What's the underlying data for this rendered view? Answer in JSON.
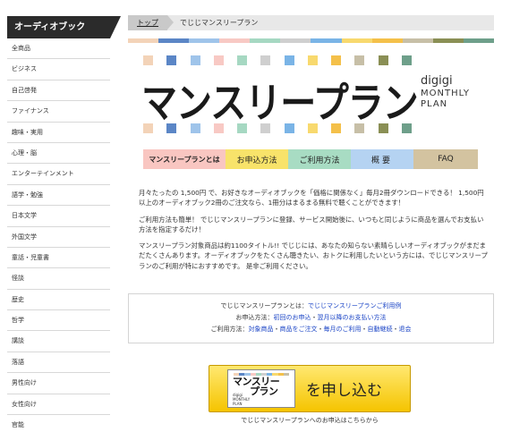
{
  "sidebar": {
    "heading": "オーディオブック",
    "items": [
      {
        "label": "全商品"
      },
      {
        "label": "ビジネス"
      },
      {
        "label": "自己啓発"
      },
      {
        "label": "ファイナンス"
      },
      {
        "label": "趣味・実用"
      },
      {
        "label": "心理・脳"
      },
      {
        "label": "エンターテインメント"
      },
      {
        "label": "語学・勉強"
      },
      {
        "label": "日本文学"
      },
      {
        "label": "外国文学"
      },
      {
        "label": "童話・児童書"
      },
      {
        "label": "怪談"
      },
      {
        "label": "歴史"
      },
      {
        "label": "哲学"
      },
      {
        "label": "講談"
      },
      {
        "label": "落語"
      },
      {
        "label": "男性向け"
      },
      {
        "label": "女性向け"
      },
      {
        "label": "官能"
      }
    ]
  },
  "breadcrumb": {
    "home": "トップ",
    "current": "でじじマンスリープラン"
  },
  "colors": {
    "palette": [
      "#f3d3b8",
      "#5b86c6",
      "#9fc4ea",
      "#f8c9c4",
      "#a6d8c2",
      "#cfcfcf",
      "#7ab4e6",
      "#f8d96e",
      "#f4c04a",
      "#c7bfa7",
      "#8a8f55",
      "#6e9f8a"
    ]
  },
  "logo": {
    "main": "マンスリープラン",
    "side_line1": "digigi",
    "side_line2": "MONTHLY",
    "side_line3": "PLAN"
  },
  "tabs": {
    "about": "マンスリープランとは",
    "apply": "お申込方法",
    "usage": "ご利用方法",
    "overview": "概要",
    "faq": "FAQ"
  },
  "intro": {
    "p1": "月々たったの 1,500円 で、お好きなオーディオブックを「価格に関係なく」毎月2冊ダウンロードできる！ 1,500円以上のオーディオブック2冊のご注文なら、1冊分はまるまる無料で聴くことができます！",
    "p2": "ご利用方法も簡単！ でじじマンスリープランに登録、サービス開始後に、いつもと同じように商品を選んでお支払い方法を指定するだけ！",
    "p3": "マンスリープラン対象商品は約1100タイトル!! でじじには、あなたの知らない素晴らしいオーディオブックがまだまだたくさんあります。オーディオブックをたくさん聴きたい、おトクに利用したいという方には、でじじマンスリープランのご利用が特におすすめです。 是非ご利用ください。"
  },
  "linkbox": {
    "row1_label": "でじじマンスリープランとは：",
    "row1_link": "でじじマンスリープランご利用例",
    "row2_label": "お申込方法：",
    "row2_link1": "初回のお申込",
    "row2_sep": "・",
    "row2_link2": "翌月以降のお支払い方法",
    "row3_label": "ご利用方法：",
    "row3_link1": "対象商品",
    "row3_link2": "商品をご注文",
    "row3_link3": "毎月のご利用",
    "row3_link4": "自動継続",
    "row3_link5": "退会"
  },
  "apply": {
    "logo_line1": "マンスリー",
    "logo_line2": "プラン",
    "logo_sub1": "digigi",
    "logo_sub2": "MONTHLY",
    "logo_sub3": "PLAN",
    "button_text": "を申し込む",
    "caption": "でじじマンスリープランへのお申込はこちらから"
  }
}
